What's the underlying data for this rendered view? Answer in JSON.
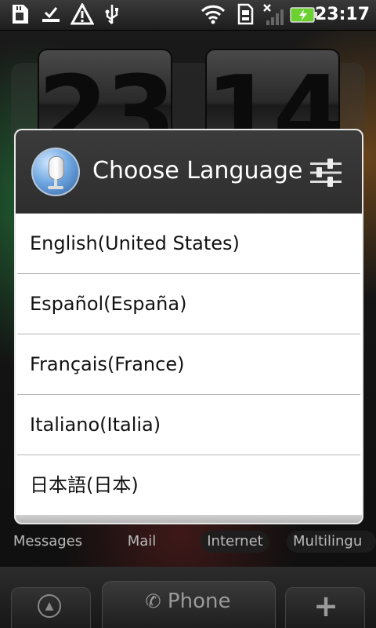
{
  "status_bar": {
    "time": "23:17",
    "icons": [
      "sd-card-icon",
      "download-done-icon",
      "warning-icon",
      "usb-icon",
      "wifi-icon",
      "sim-icon",
      "no-signal-icon",
      "battery-charging-icon"
    ]
  },
  "background_clock": {
    "hours": "23",
    "minutes": "14"
  },
  "dialog": {
    "title": "Choose Language",
    "items": [
      {
        "label": "English(United States)"
      },
      {
        "label": "Español(España)"
      },
      {
        "label": "Français(France)"
      },
      {
        "label": "Italiano(Italia)"
      },
      {
        "label": "日本語(日本)"
      }
    ]
  },
  "home_apps": {
    "labels": [
      "Messages",
      "Mail",
      "Internet",
      "Multilingu"
    ]
  },
  "dock": {
    "phone_label": "Phone"
  },
  "colors": {
    "dialog_header": "#2e2e2e",
    "list_background": "#ffffff",
    "divider": "#b5b5b5"
  }
}
